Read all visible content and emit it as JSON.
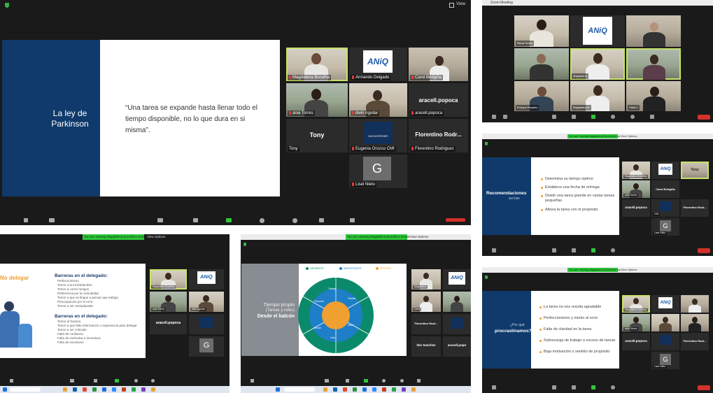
{
  "main": {
    "view_label": "View",
    "slide_title": "La ley de Parkinson",
    "slide_quote": "“Una tarea se expande hasta llenar todo el tiempo disponible, no lo que dura en si misma”.",
    "tiles": [
      {
        "name": "Magdalena Bocelha"
      },
      {
        "name": "Armando Delgado"
      },
      {
        "name": "Carol Bridgiña"
      },
      {
        "name": "ania Torres"
      },
      {
        "name": "dwin Aguilar"
      },
      {
        "big": "aracell.popoca",
        "name": "aracell.popoca"
      },
      {
        "big": "Tony",
        "name": "Tony"
      },
      {
        "name": "Eugenia Orozco CMI"
      },
      {
        "big": "Florentino Rodr...",
        "name": "Florentino Rodriguez"
      },
      {
        "name": "Lisel Nieto"
      }
    ],
    "aniq": "ANiQ",
    "cmi_label": "CMI INTERSER",
    "g_letter": "G"
  },
  "gallery": {
    "title": "Zoom Meeting",
    "aniq": "ANiQ",
    "names": [
      "Elena Torres",
      "ANiQ",
      "Carol",
      "",
      "Magdalena",
      "",
      "Enrique Rosales",
      "Magdalena B",
      "Hilda C"
    ]
  },
  "reco": {
    "banner": "You are viewing Magdalena Bocelha's screen",
    "view_options": "View Options",
    "slide_title": "Recomendaciones",
    "slide_sub": "del líder",
    "bullets": [
      "Determina su tiempo óptimo",
      "Establece una fecha de entrega",
      "Divide una tarea grande en varias tareas pequeñas",
      "Alinea la tarea con el propósito"
    ],
    "tiles": [
      {
        "name": "Magdalena Bocelha"
      },
      {
        "big": "ANiQ"
      },
      {
        "big": "Tony",
        "name": "Tony"
      },
      {
        "name": "ania Torres"
      },
      {
        "name": "Carol Bridgiña"
      },
      {
        "big": "aracell.popoca",
        "name": "aracell.popoca"
      },
      {
        "name": "CMI"
      },
      {
        "big": "Florentino Rodr...",
        "name": "Florentino Rodriguez"
      },
      {
        "big": "G",
        "name": "Lisel Nieto"
      }
    ]
  },
  "deleg": {
    "banner": "You are viewing Magdalena Bocelha's screen",
    "view_options": "View Options",
    "heading": "No delegar",
    "h1": "Barreras en el delegado:",
    "list1": [
      "Perfeccionismo",
      "Temor a la incertidumbre",
      "Temor a correr riesgos",
      "Preferencia por la comodidad",
      "Temor a que se llegue a pensar que trabaja",
      "Preocupación por el error",
      "Temor a ser reemplazado"
    ],
    "h2": "Barreras en el delegado:",
    "list2": [
      "Temor al fracaso",
      "Temor a que falte información o experiencia para delegar",
      "Temor a ser criticado",
      "Falta de confianza",
      "Falta de estímulos e incentivos",
      "Falta de incentivos"
    ],
    "tiles": [
      {
        "name": "Magdalena Bocelha"
      },
      {
        "big": "ANiQ"
      },
      {
        "name": "ania Torres"
      },
      {
        "name": "dwin Aguilar"
      },
      {
        "big": "aracell.popoca",
        "name": "aracell.popoca"
      },
      {
        "name": "CMI"
      },
      {
        "big": "G",
        "name": "Lisel Nieto"
      }
    ]
  },
  "time": {
    "banner": "You are viewing Magdalena Bocelha's screen",
    "view_options": "View Options",
    "title_line1": "Tiempo propio",
    "title_line2": "(Tareas y roles)",
    "title_bold": "Desde el balcón",
    "legend": [
      "URGENTE",
      "IMPORTANTE",
      "ÓPTIMO"
    ],
    "wheel_labels": [
      "Trabajo",
      "Familia",
      "Personal",
      "Salud",
      "Social",
      "Ocio"
    ],
    "tiles": [
      {
        "name": "Magdalena"
      },
      {
        "big": "ANiQ"
      },
      {
        "name": "Carol"
      },
      {
        "big": "Florentino Rodr...",
        "name": "Florentino"
      },
      {
        "big": "Ilse Sanchez",
        "name": "Ilse Sanchez"
      },
      {
        "big": "aracell.popo",
        "name": "aracell"
      }
    ]
  },
  "procr": {
    "banner": "You are viewing Magdalena Bocelha's screen",
    "view_options": "View Options",
    "title_line1": "¿Por qué",
    "title_line2": "procrastinamos?",
    "bullets": [
      "La tarea no nos resulta agradable",
      "Perfeccionismo y miedo al error",
      "Falta de claridad en la tarea",
      "Sobrecarga de trabajo o exceso de tareas",
      "Baja motivación o sentido de propósito"
    ],
    "tiles": [
      {
        "name": "Magdalena Bocelha"
      },
      {
        "big": "ANiQ"
      },
      {
        "name": "Carol"
      },
      {
        "name": "ania Torres"
      },
      {
        "name": "Elena"
      },
      {
        "big": "aracell.popoca",
        "name": "aracell.popoca"
      },
      {
        "name": "CMI"
      },
      {
        "big": "Florentino Rodr...",
        "name": "Florentino"
      },
      {
        "big": "G",
        "name": "Lisel Nieto"
      }
    ]
  }
}
